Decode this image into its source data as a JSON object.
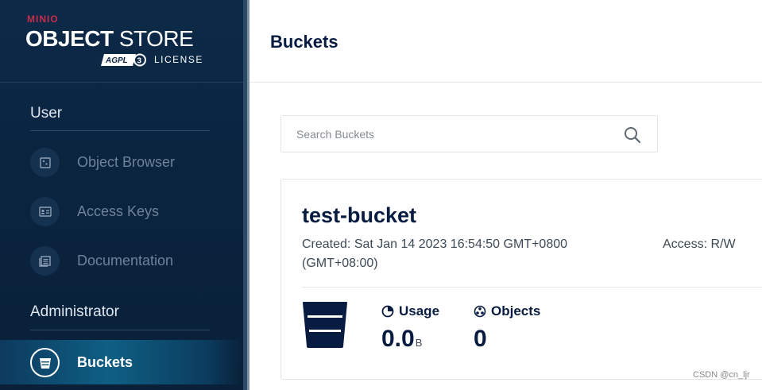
{
  "app": {
    "brand": "MINIO",
    "title_bold": "OBJECT",
    "title_light": "STORE",
    "license_badge": "AGPL v3",
    "license_label": "LICENSE"
  },
  "sidebar": {
    "sections": [
      {
        "title": "User",
        "items": [
          {
            "label": "Object Browser",
            "icon": "object-browser-icon"
          },
          {
            "label": "Access Keys",
            "icon": "access-keys-icon"
          },
          {
            "label": "Documentation",
            "icon": "documentation-icon"
          }
        ]
      },
      {
        "title": "Administrator",
        "items": [
          {
            "label": "Buckets",
            "icon": "bucket-icon",
            "active": true
          }
        ]
      }
    ]
  },
  "header": {
    "title": "Buckets"
  },
  "search": {
    "placeholder": "Search Buckets",
    "value": ""
  },
  "bucket": {
    "name": "test-bucket",
    "created": "Created: Sat Jan 14 2023 16:54:50 GMT+0800 (GMT+08:00)",
    "access": "Access: R/W",
    "usage_label": "Usage",
    "usage_value": "0.0",
    "usage_unit": "B",
    "objects_label": "Objects",
    "objects_value": "0"
  },
  "watermark": "CSDN @cn_ljr"
}
